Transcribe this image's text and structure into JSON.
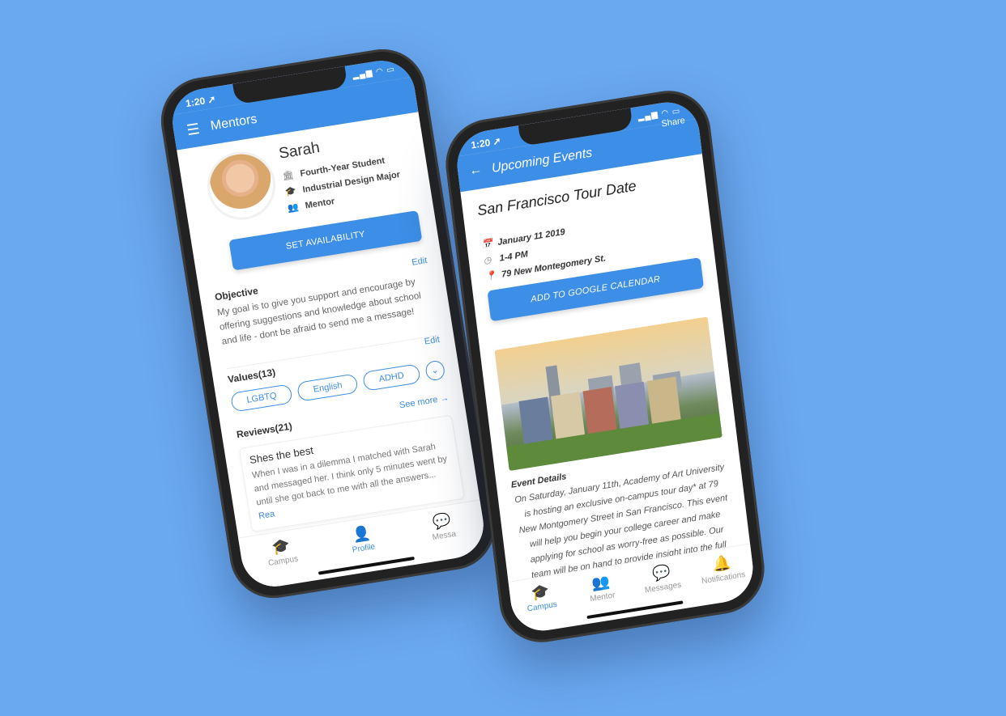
{
  "colors": {
    "background": "#6aa8f0",
    "primary": "#3d8ee6"
  },
  "phone1": {
    "status_time": "1:20 ➚",
    "title": "Mentors",
    "profile": {
      "name": "Sarah",
      "year": "Fourth-Year Student",
      "major": "Industrial Design Major",
      "role": "Mentor"
    },
    "set_availability": "SET AVAILABILITY",
    "objective": {
      "title": "Objective",
      "edit": "Edit",
      "text": "My goal is to give you support and encourage by offering suggestions and knowledge about school and life - dont be afraid to send me a message!"
    },
    "values": {
      "title": "Values(13)",
      "edit": "Edit",
      "chips": [
        "LGBTQ",
        "English",
        "ADHD"
      ]
    },
    "reviews": {
      "title": "Reviews(21)",
      "see_more": "See more →",
      "card_title": "Shes the best",
      "card_text": "When I was in a dilemma I matched with Sarah and messaged her. I think only 5 minutes went by until she got back to me with all the answers...",
      "read_more": "Rea"
    },
    "tabs": [
      "Campus",
      "Profile",
      "Messa"
    ]
  },
  "phone2": {
    "status_time": "1:20 ➚",
    "title": "Upcoming Events",
    "share": "Share",
    "event": {
      "title": "San Francisco Tour Date",
      "date": "January 11 2019",
      "time": "1-4 PM",
      "location": "79 New Montegomery St."
    },
    "add_calendar": "ADD TO GOOGLE CALENDAR",
    "details": {
      "heading": "Event Details",
      "text": "On Saturday, January 11th, Academy of Art University is hosting an exclusive on-campus tour day* at 79 New Montgomery Street in San Francisco. This event will help you begin your college career and make applying for school as worry-free as possible. Our team will be on hand to provide insight into the full Academy experience, including student"
    },
    "tabs": [
      "Campus",
      "Mentor",
      "Messages",
      "Notifications"
    ]
  }
}
